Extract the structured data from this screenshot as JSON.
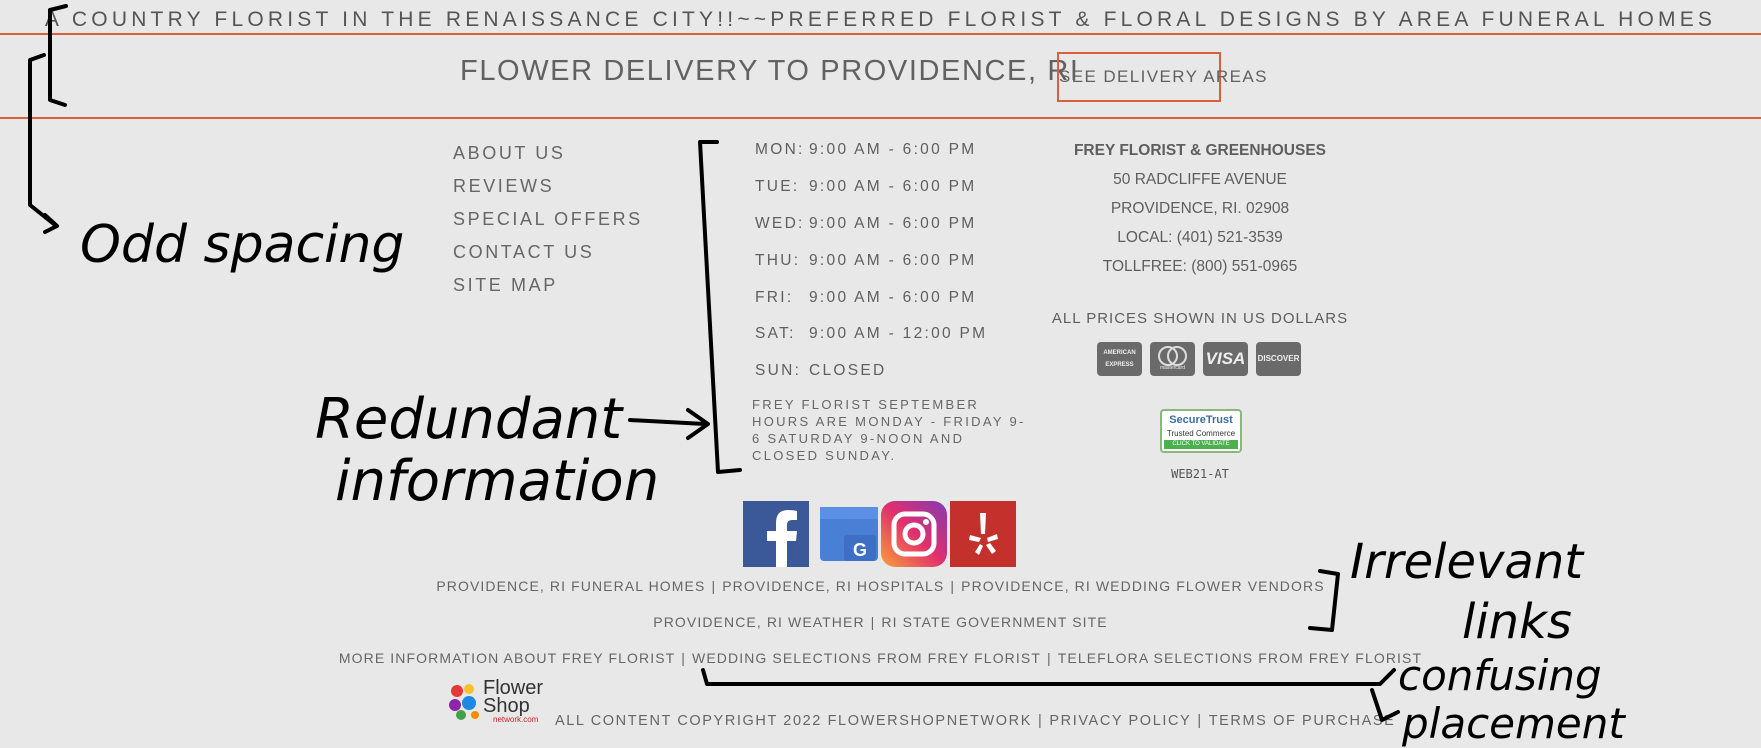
{
  "tagline": "A COUNTRY FLORIST IN THE RENAISSANCE CITY!!~~PREFERRED FLORIST & FLORAL DESIGNS BY AREA FUNERAL HOMES",
  "delivery": {
    "title": "FLOWER DELIVERY TO PROVIDENCE, RI",
    "button": "SEE DELIVERY AREAS"
  },
  "nav": [
    "ABOUT US",
    "REVIEWS",
    "SPECIAL OFFERS",
    "CONTACT US",
    "SITE MAP"
  ],
  "hours": [
    {
      "day": "MON:",
      "time": "9:00 AM - 6:00 PM"
    },
    {
      "day": "TUE:",
      "time": "9:00 AM - 6:00 PM"
    },
    {
      "day": "WED:",
      "time": "9:00 AM - 6:00 PM"
    },
    {
      "day": "THU:",
      "time": "9:00 AM - 6:00 PM"
    },
    {
      "day": "FRI:",
      "time": "9:00 AM - 6:00 PM"
    },
    {
      "day": "SAT:",
      "time": "9:00 AM - 12:00 PM"
    },
    {
      "day": "SUN:",
      "time": "CLOSED"
    }
  ],
  "hours_note": "FREY FLORIST SEPTEMBER HOURS ARE MONDAY - FRIDAY 9-6 SATURDAY 9-NOON AND CLOSED SUNDAY.",
  "address": {
    "name": "FREY FLORIST & GREENHOUSES",
    "street": "50 RADCLIFFE AVENUE",
    "city": "PROVIDENCE, RI. 02908",
    "local": "LOCAL: (401) 521-3539",
    "tollfree": "TOLLFREE: (800) 551-0965"
  },
  "prices_note": "ALL PRICES SHOWN IN US DOLLARS",
  "cards": [
    "AMERICAN EXPRESS",
    "mastercard",
    "VISA",
    "DISCOVER"
  ],
  "secure_badge": {
    "line1": "SecureTrust",
    "line2": "Trusted Commerce",
    "line3": "CLICK TO VALIDATE"
  },
  "web_code": "WEB21-AT",
  "social_icons": [
    "facebook-icon",
    "google-business-icon",
    "instagram-icon",
    "yelp-icon"
  ],
  "link_rows": [
    [
      "PROVIDENCE, RI FUNERAL HOMES",
      "PROVIDENCE, RI HOSPITALS",
      "PROVIDENCE, RI WEDDING FLOWER VENDORS"
    ],
    [
      "PROVIDENCE, RI WEATHER",
      "RI STATE GOVERNMENT SITE"
    ],
    [
      "MORE INFORMATION ABOUT FREY FLORIST",
      "WEDDING SELECTIONS FROM FREY FLORIST",
      "TELEFLORA SELECTIONS FROM FREY FLORIST"
    ]
  ],
  "footer": {
    "logo_text": "Flower Shop",
    "logo_sub": "network.com",
    "copyright": "ALL CONTENT COPYRIGHT 2022 FLOWERSHOPNETWORK",
    "privacy": "PRIVACY POLICY",
    "terms": "TERMS OF PURCHASE"
  },
  "annotations": {
    "odd_spacing": "Odd spacing",
    "redundant_1": "Redundant",
    "redundant_2": "information",
    "irrelevant_1": "Irrelevant",
    "irrelevant_2": "links",
    "confusing_1": "confusing",
    "confusing_2": "placement"
  },
  "colors": {
    "accent": "#d9603b",
    "background": "#e8e8e8",
    "text": "#5a5a5a",
    "facebook": "#3b5998",
    "yelp": "#c4302b"
  }
}
